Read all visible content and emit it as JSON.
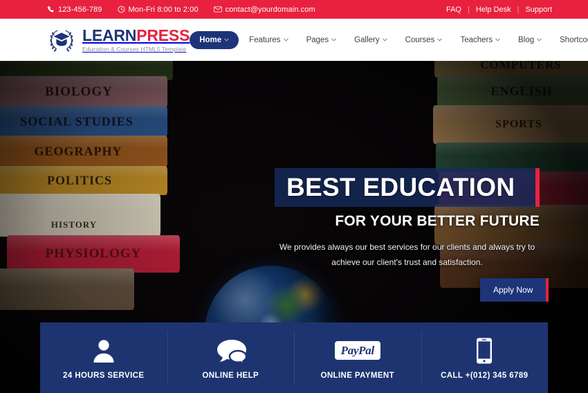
{
  "topbar": {
    "phone": "123-456-789",
    "hours": "Mon-Fri 8:00 to 2:00",
    "email": "contact@yourdomain.com",
    "links": [
      "FAQ",
      "Help Desk",
      "Support"
    ],
    "separator": "|",
    "background_color": "#e8213e"
  },
  "header": {
    "logo": {
      "name_part1": "LEARN",
      "name_part2": "PRESS",
      "tagline": "Education & Courses HTML5 Template",
      "color_primary": "#1d3478",
      "color_accent": "#e8213e"
    },
    "nav": [
      {
        "label": "Home",
        "active": true
      },
      {
        "label": "Features",
        "active": false
      },
      {
        "label": "Pages",
        "active": false
      },
      {
        "label": "Gallery",
        "active": false
      },
      {
        "label": "Courses",
        "active": false
      },
      {
        "label": "Teachers",
        "active": false
      },
      {
        "label": "Blog",
        "active": false
      },
      {
        "label": "Shortcodes",
        "active": false
      }
    ]
  },
  "hero": {
    "headline": "BEST EDUCATION",
    "subheadline": "FOR YOUR BETTER FUTURE",
    "paragraph": "We provides always our best services for our clients and always try to achieve our client's trust and satisfaction.",
    "cta_label": "Apply Now",
    "band_color": "#162c5e",
    "accent_color": "#e8213e",
    "books_left": [
      {
        "title": "BIOLOGY",
        "color": "#9b6b74"
      },
      {
        "title": "SOCIAL STUDIES",
        "color": "#2f5e9e"
      },
      {
        "title": "GEOGRAPHY",
        "color": "#a8601f"
      },
      {
        "title": "POLITICS",
        "color": "#c99427"
      },
      {
        "title": "HISTORY",
        "color": "#ddd6c2"
      },
      {
        "title": "PHYSIOLOGY",
        "color": "#c0203a"
      }
    ],
    "books_right": [
      {
        "title": "COMPUTERS",
        "color": "#a98a53"
      },
      {
        "title": "ENGLISH",
        "color": "#5d7a4a"
      },
      {
        "title": "SPORTS",
        "color": "#c79a62"
      }
    ]
  },
  "features": [
    {
      "label": "24 HOURS SERVICE",
      "icon": "user-icon"
    },
    {
      "label": "ONLINE HELP",
      "icon": "chat-bubbles-icon"
    },
    {
      "label": "ONLINE PAYMENT",
      "icon": "paypal-icon",
      "brand": "PayPal"
    },
    {
      "label": "CALL +(012) 345 6789",
      "icon": "smartphone-icon"
    }
  ]
}
